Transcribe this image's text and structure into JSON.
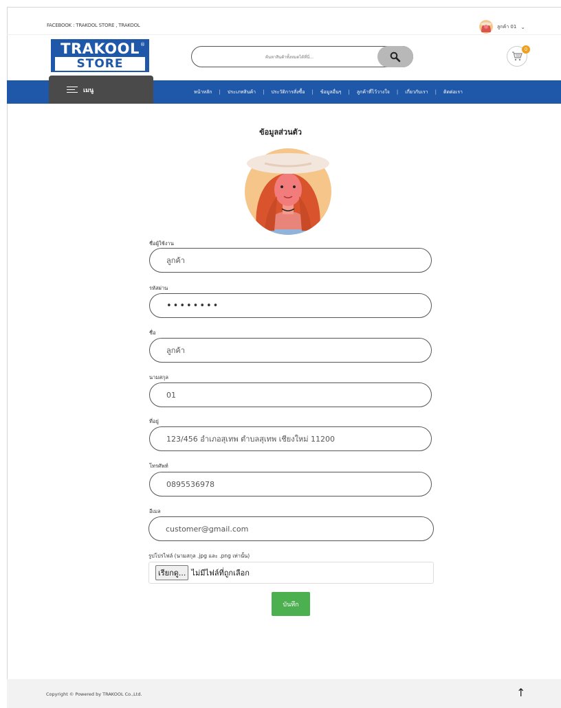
{
  "header": {
    "facebook_text": "FACEBOOK : TRAKOOL STORE , TRAKOOL",
    "user_name": "ลูกค้า 01",
    "cart_count": "0"
  },
  "logo": {
    "line1": "TRAKOOL",
    "line2": "STORE",
    "reg": "®"
  },
  "search": {
    "placeholder": "ค้นหาสินค้าทั้งหมดได้ที่นี่..."
  },
  "nav": {
    "menu_label": "เมนู",
    "items": [
      "หน้าหลัก",
      "ประเภทสินค้า",
      "ประวัติการสั่งซื้อ",
      "ข้อมูลอื่นๆ",
      "ลูกค้าที่ไว้วางใจ",
      "เกี่ยวกับเรา",
      "ติดต่อเรา"
    ]
  },
  "page_title": "ข้อมูลส่วนตัว",
  "form": {
    "username": {
      "label": "ชื่อผู้ใช้งาน",
      "value": "ลูกค้า"
    },
    "password": {
      "label": "รหัสผ่าน",
      "value": "••••••••"
    },
    "first_name": {
      "label": "ชื่อ",
      "value": "ลูกค้า"
    },
    "last_name": {
      "label": "นามสกุล",
      "value": "01"
    },
    "address": {
      "label": "ที่อยู่",
      "value": "123/456 อำเภอสุเทพ ตำบลสุเทพ เชียงใหม่ 11200"
    },
    "phone": {
      "label": "โทรศัพท์",
      "value": "0895536978"
    },
    "email": {
      "label": "อีเมล",
      "value": "customer@gmail.com"
    },
    "profile_image": {
      "label": "รูปโปรไฟล์ (นามสกุล .jpg และ .png เท่านั้น)",
      "browse_label": "เรียกดู...",
      "status": "ไม่มีไฟล์ที่ถูกเลือก"
    },
    "save_label": "บันทึก"
  },
  "footer": {
    "copyright": "Copyright © Powered by TRAKOOL Co.,Ltd.",
    "to_top": "↑"
  },
  "colors": {
    "brand_blue": "#1f58a8",
    "menu_dark": "#4a4a4a",
    "save_green": "#4caf50",
    "badge_orange": "#f0a020"
  },
  "icons": {
    "search": "search-icon",
    "cart": "cart-icon",
    "menu": "hamburger-icon",
    "chevron": "chevron-down-icon",
    "to_top": "arrow-up-icon"
  }
}
